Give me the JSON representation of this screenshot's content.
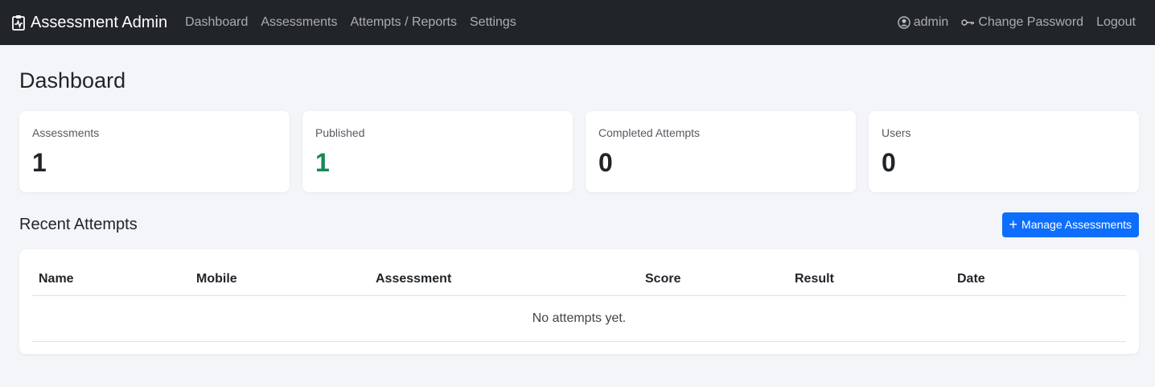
{
  "navbar": {
    "brand": "Assessment Admin",
    "brand_icon": "clipboard-pulse-icon",
    "links": [
      "Dashboard",
      "Assessments",
      "Attempts / Reports",
      "Settings"
    ],
    "user": "admin",
    "change_password": "Change Password",
    "logout": "Logout"
  },
  "page": {
    "title": "Dashboard"
  },
  "stats": [
    {
      "label": "Assessments",
      "value": "1"
    },
    {
      "label": "Published",
      "value": "1",
      "color": "#198754"
    },
    {
      "label": "Completed Attempts",
      "value": "0"
    },
    {
      "label": "Users",
      "value": "0"
    }
  ],
  "recent": {
    "title": "Recent Attempts",
    "manage_button": "Manage Assessments",
    "columns": [
      "Name",
      "Mobile",
      "Assessment",
      "Score",
      "Result",
      "Date"
    ],
    "empty_text": "No attempts yet."
  }
}
